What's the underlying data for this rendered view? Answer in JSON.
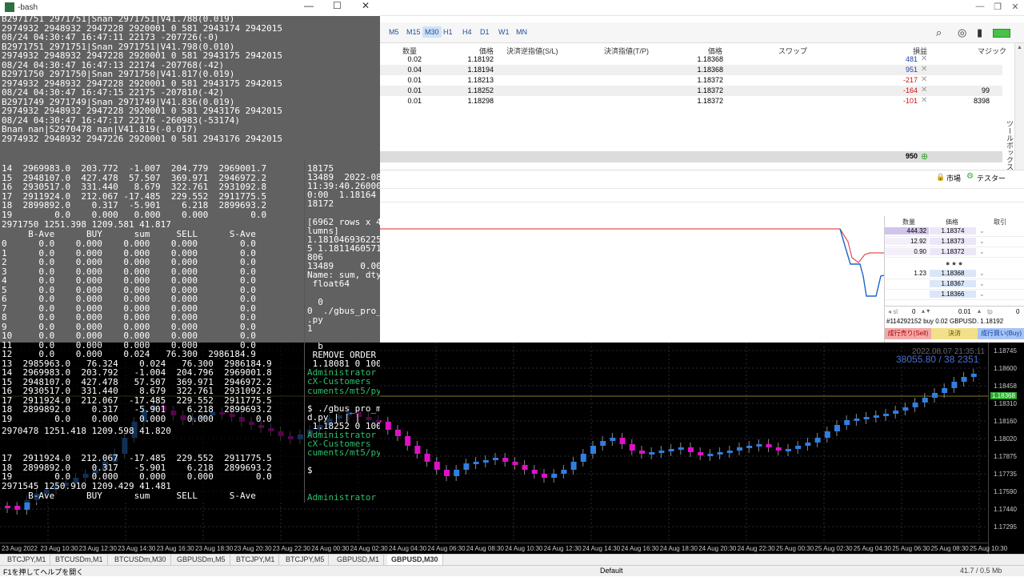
{
  "terminal": {
    "title": "-bash",
    "lines_top": [
      "B2971751 2971751|Snan 2971751|V41.788(0.019)",
      "2974932 2948932 2947228 2920001 0 581 2943174 2942015",
      "08/24 04:30:47 16:47:11 22173 -207726(-0)",
      "B2971751 2971751|Snan 2971751|V41.798(0.010)",
      "2974932 2948932 2947228 2920001 0 581 2943175 2942015",
      "08/24 04:30:47 16:47:13 22174 -207768(-42)",
      "B2971750 2971750|Snan 2971750|V41.817(0.019)",
      "2974932 2948932 2947228 2920001 0 581 2943175 2942015",
      "08/24 04:30:47 16:47:15 22175 -207810(-42)",
      "B2971749 2971749|Snan 2971749|V41.836(0.019)",
      "2974932 2948932 2947228 2920001 0 581 2943176 2942015",
      "08/24 04:30:47 16:47:17 22176 -260983(-53174)",
      "Bnan nan|S2970478 nan|V41.819(-0.017)",
      "2974932 2948932 2947226 2920001 0 581 2943176 2942015"
    ],
    "table1_rows": [
      "14  2969983.0  203.772  -1.007  204.779  2969001.7",
      "15  2948107.0  427.478  57.507  369.971  2946972.2",
      "16  2930517.0  331.440   8.679  322.761  2931092.8",
      "17  2911924.0  212.067 -17.485  229.552  2911775.5",
      "18  2899892.0    0.317  -5.901    6.218  2899693.2",
      "19        0.0    0.000   0.000    0.000        0.0"
    ],
    "summary_line": "2971750 1251.398 1209.581 41.817",
    "table2_header": "     B-Ave      BUY      sum     SELL      S-Ave",
    "table2_rows": [
      "0      0.0    0.000    0.000    0.000        0.0",
      "1      0.0    0.000    0.000    0.000        0.0",
      "2      0.0    0.000    0.000    0.000        0.0",
      "3      0.0    0.000    0.000    0.000        0.0",
      "4      0.0    0.000    0.000    0.000        0.0",
      "5      0.0    0.000    0.000    0.000        0.0",
      "6      0.0    0.000    0.000    0.000        0.0",
      "7      0.0    0.000    0.000    0.000        0.0",
      "8      0.0    0.000    0.000    0.000        0.0",
      "9      0.0    0.000    0.000    0.000        0.0",
      "10     0.0    0.000    0.000    0.000        0.0",
      "11     0.0    0.000    0.000    0.000        0.0",
      "12     0.0    0.000    0.024   76.300  2986184.9",
      "13  2985963.0   76.324    0.024   76.300  2986184.9",
      "14  2969983.0  203.792   -1.004  204.796  2969001.8",
      "15  2948107.0  427.478   57.507  369.971  2946972.2",
      "16  2930517.0  331.440    8.679  322.761  2931092.8",
      "17  2911924.0  212.067  -17.485  229.552  2911775.5",
      "18  2899892.0    0.317   -5.901    6.218  2899693.2",
      "19        0.0    0.000    0.000    0.000        0.0"
    ],
    "summary_line2": "2970478 1251.418 1209.598 41.820",
    "table3_rows": [
      "17  2911924.0  212.067  -17.485  229.552  2911775.5",
      "18  2899892.0    0.317   -5.901    6.218  2899693.2",
      "19        0.0    0.000    0.000    0.000        0.0"
    ],
    "summary_line3": "2971545 1250.910 1209.429 41.481",
    "table3_header": "     B-Ave      BUY      sum     SELL      S-Ave",
    "right_col": [
      "18175         2",
      "13489  2022-08-",
      "11:39:40.26000",
      "0:00  1.18164",
      "18172         4",
      "",
      "[6962 rows x 4",
      "lumns]",
      "1.181046936225",
      "5 1.1811460571",
      "806",
      "13489     0.000",
      "Name: sum, dty",
      " float64",
      "",
      "  0",
      "0  ./gbus_pro_",
      ".py",
      "1",
      "",
      "  b",
      " REMOVE ORDER",
      " 1.18081 0 1000",
      "Administrator",
      "cX-Customers",
      "cuments/mt5/py",
      "",
      "$ ./gbus_pro_m",
      "d.py | | |",
      " 1.18252 0 1000",
      "Administrator",
      "cX-Customers",
      "cuments/mt5/py",
      "",
      "$ ",
      "",
      "",
      "Administrator"
    ]
  },
  "mt5": {
    "timeframes": [
      "M5",
      "M15",
      "M30",
      "H1",
      "H4",
      "D1",
      "W1",
      "MN"
    ],
    "active_timeframe": "M30",
    "positions": {
      "headers": [
        "数量",
        "価格",
        "決済逆指値(S/L)",
        "決済指値(T/P)",
        "価格",
        "スワップ",
        "損益",
        "マジック"
      ],
      "rows": [
        {
          "volume": "0.02",
          "open": "1.18192",
          "sl": "",
          "tp": "",
          "price": "1.18368",
          "swap": "",
          "profit": "481",
          "magic": ""
        },
        {
          "volume": "0.04",
          "open": "1.18194",
          "sl": "",
          "tp": "",
          "price": "1.18368",
          "swap": "",
          "profit": "951",
          "magic": ""
        },
        {
          "volume": "0.01",
          "open": "1.18213",
          "sl": "",
          "tp": "",
          "price": "1.18372",
          "swap": "",
          "profit": "-217",
          "magic": ""
        },
        {
          "volume": "0.01",
          "open": "1.18252",
          "sl": "",
          "tp": "",
          "price": "1.18372",
          "swap": "",
          "profit": "-164",
          "magic": "99"
        },
        {
          "volume": "0.01",
          "open": "1.18298",
          "sl": "",
          "tp": "",
          "price": "1.18372",
          "swap": "",
          "profit": "-101",
          "magic": "8398"
        }
      ],
      "total": "950"
    },
    "status_links": [
      "市場",
      "テスター"
    ],
    "side_label": "ツールボックス",
    "dom": {
      "headers": [
        "数量",
        "価格",
        "取引"
      ],
      "asks": [
        {
          "vol": "444.32",
          "price": "1.18374"
        },
        {
          "vol": "12.92",
          "price": "1.18373"
        },
        {
          "vol": "0.90",
          "price": "1.18372"
        }
      ],
      "bids": [
        {
          "vol": "1.23",
          "price": "1.18368"
        },
        {
          "vol": "",
          "price": "1.18367"
        },
        {
          "vol": "",
          "price": "1.18366"
        }
      ],
      "sl_value": "0",
      "volume_value": "0.01",
      "tp_value": "0",
      "order_info": "#114292152 buy 0.02 GBPUSD. 1.18192",
      "sell_label": "成行売り(Sell)",
      "close_label": "決済",
      "buy_label": "成行買い(Buy)"
    },
    "chart": {
      "overlay_time": "2022.08.07 21:35:11",
      "overlay_info": "38055.80 / 38 2351",
      "current_price": "1.18368",
      "price_labels": [
        "1.18745",
        "1.18600",
        "1.18458",
        "1.18310",
        "1.18160",
        "1.18020",
        "1.17875",
        "1.17735",
        "1.17590",
        "1.17440",
        "1.17295"
      ],
      "time_labels": [
        "23 Aug 2022",
        "23 Aug 10:30",
        "23 Aug 12:30",
        "23 Aug 14:30",
        "23 Aug 16:30",
        "23 Aug 18:30",
        "23 Aug 20:30",
        "23 Aug 22:30",
        "24 Aug 00:30",
        "24 Aug 02:30",
        "24 Aug 04:30",
        "24 Aug 06:30",
        "24 Aug 08:30",
        "24 Aug 10:30",
        "24 Aug 12:30",
        "24 Aug 14:30",
        "24 Aug 16:30",
        "24 Aug 18:30",
        "24 Aug 20:30",
        "24 Aug 22:30",
        "25 Aug 00:30",
        "25 Aug 02:30",
        "25 Aug 04:30",
        "25 Aug 06:30",
        "25 Aug 08:30",
        "25 Aug 10:30"
      ]
    },
    "tabs": [
      "BTCJPY,M1",
      "BTCUSDm,M1",
      "BTCUSDm,M30",
      "GBPUSDm,M5",
      "BTCJPY,M1",
      "BTCJPY,M5",
      "GBPUSD,M1",
      "GBPUSD,M30"
    ],
    "active_tab_index": 7,
    "statusbar": {
      "left": "F1を押してヘルプを開く",
      "center": "Default",
      "right": "41.7 / 0.5 Mb"
    }
  },
  "colors": {
    "up": "#2f7fe0",
    "down": "#e010c8",
    "ask_bg": "#ece6f7",
    "bid_bg": "#dbe6f8"
  }
}
